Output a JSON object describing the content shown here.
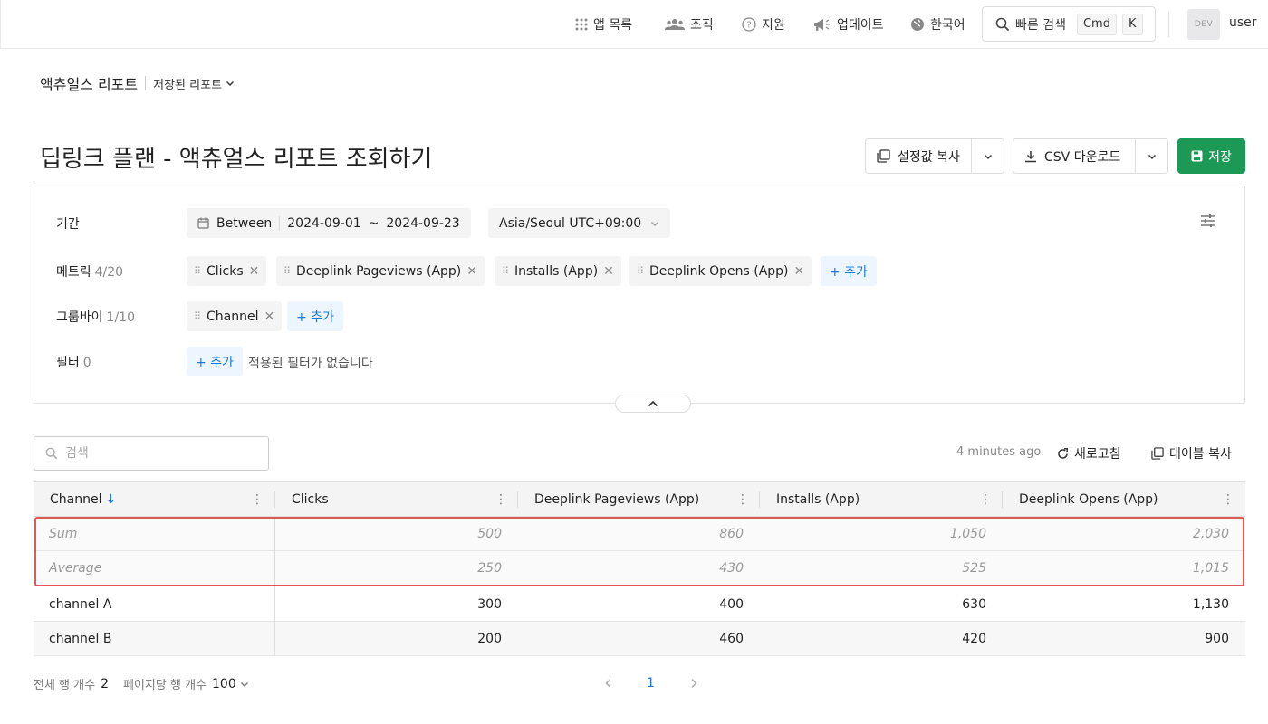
{
  "topnav": {
    "apps": "앱 목록",
    "org": "조직",
    "support": "지원",
    "updates": "업데이트",
    "language": "한국어",
    "quick_search": "빠른 검색",
    "kbd_cmd": "Cmd",
    "kbd_k": "K",
    "avatar": "DEV",
    "user": "user"
  },
  "breadcrumb": {
    "main": "액츄얼스 리포트",
    "sub": "저장된 리포트"
  },
  "page": {
    "title": "딥링크 플랜 - 액츄얼스 리포트 조회하기",
    "copy_settings": "설정값 복사",
    "csv_download": "CSV 다운로드",
    "save": "저장"
  },
  "filters": {
    "period_label": "기간",
    "date_mode": "Between",
    "date_start": "2024-09-01",
    "date_tilde": "~",
    "date_end": "2024-09-23",
    "timezone": "Asia/Seoul UTC+09:00",
    "metrics_label": "메트릭",
    "metrics_count": "4/20",
    "metrics": [
      "Clicks",
      "Deeplink Pageviews (App)",
      "Installs (App)",
      "Deeplink Opens (App)"
    ],
    "groupby_label": "그룹바이",
    "groupby_count": "1/10",
    "groupby": [
      "Channel"
    ],
    "filter_label": "필터",
    "filter_count": "0",
    "add": "+ 추가",
    "no_filter": "적용된 필터가 없습니다"
  },
  "table_toolbar": {
    "search_placeholder": "검색",
    "updated": "4 minutes ago",
    "refresh": "새로고침",
    "copy_table": "테이블 복사"
  },
  "table": {
    "columns": [
      "Channel",
      "Clicks",
      "Deeplink Pageviews (App)",
      "Installs (App)",
      "Deeplink Opens (App)"
    ],
    "sort_arrow": "↓",
    "aggregates": [
      {
        "label": "Sum",
        "values": [
          "500",
          "860",
          "1,050",
          "2,030"
        ]
      },
      {
        "label": "Average",
        "values": [
          "250",
          "430",
          "525",
          "1,015"
        ]
      }
    ],
    "rows": [
      {
        "label": "channel A",
        "values": [
          "300",
          "400",
          "630",
          "1,130"
        ]
      },
      {
        "label": "channel B",
        "values": [
          "200",
          "460",
          "420",
          "900"
        ]
      }
    ]
  },
  "footer": {
    "total_rows_label": "전체 행 개수",
    "total_rows": "2",
    "per_page_label": "페이지당 행 개수",
    "per_page": "100",
    "current_page": "1"
  }
}
